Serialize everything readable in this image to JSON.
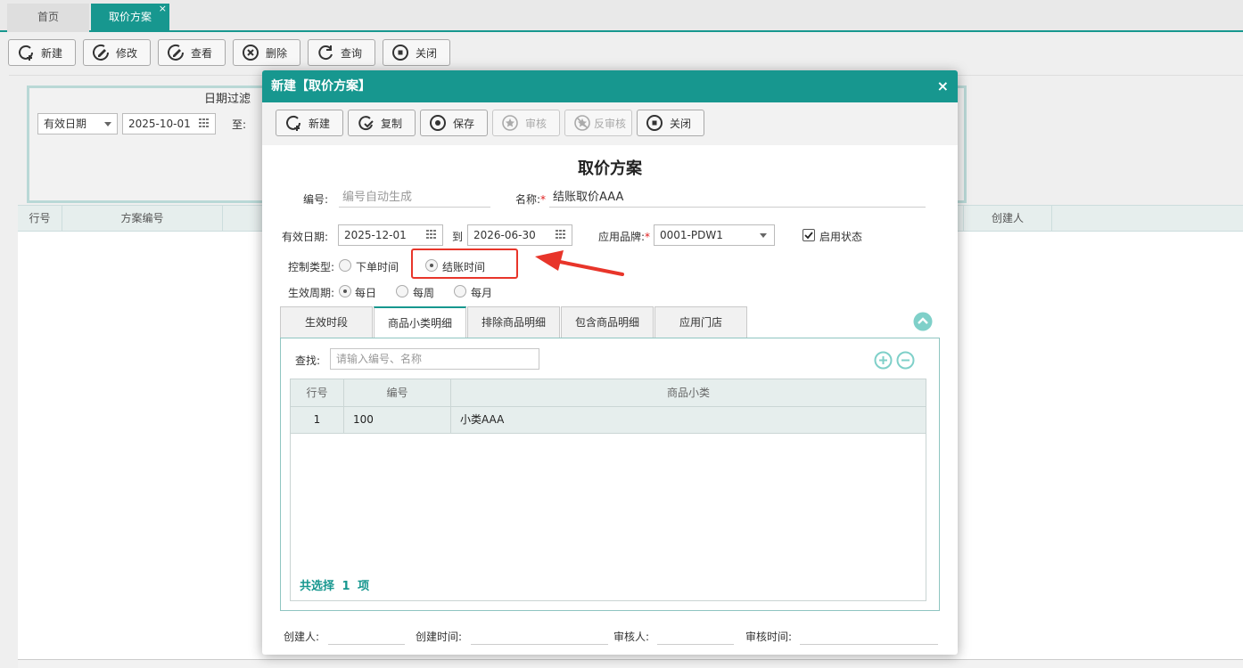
{
  "tabs": [
    {
      "label": "首页"
    },
    {
      "label": "取价方案",
      "close": "×"
    }
  ],
  "toolbar": {
    "new": "新建",
    "edit": "修改",
    "view": "查看",
    "delete": "删除",
    "query": "查询",
    "close": "关闭"
  },
  "filter": {
    "title": "日期过滤",
    "date_type": "有效日期",
    "start_date": "2025-10-01",
    "to_label": "至:"
  },
  "bg_grid": {
    "columns": [
      "行号",
      "方案编号",
      "创建人"
    ]
  },
  "dialog": {
    "title": "新建【取价方案】",
    "close": "×",
    "toolbar": {
      "new": "新建",
      "copy": "复制",
      "save": "保存",
      "audit": "审核",
      "unaudit": "反审核",
      "close": "关闭"
    },
    "form_title": "取价方案",
    "code_label": "编号:",
    "code_placeholder": "编号自动生成",
    "name_label": "名称:",
    "name_value": "结账取价AAA",
    "valid_date_label": "有效日期:",
    "start_date": "2025-12-01",
    "to_label": "到",
    "end_date": "2026-06-30",
    "brand_label": "应用品牌:",
    "brand_value": "0001-PDW1",
    "enabled_label": "启用状态",
    "enabled": true,
    "control_type_label": "控制类型:",
    "control_options": [
      "下单时间",
      "结账时间"
    ],
    "control_selected": "结账时间",
    "period_label": "生效周期:",
    "period_options": [
      "每日",
      "每周",
      "每月"
    ],
    "period_selected": "每日",
    "inner_tabs": [
      "生效时段",
      "商品小类明细",
      "排除商品明细",
      "包含商品明细",
      "应用门店"
    ],
    "active_inner_tab": "商品小类明细",
    "search_label": "查找:",
    "search_placeholder": "请输入编号、名称",
    "grid": {
      "columns": [
        "行号",
        "编号",
        "商品小类"
      ],
      "rows": [
        {
          "row": "1",
          "code": "100",
          "category": "小类AAA"
        }
      ]
    },
    "selection_summary": {
      "prefix": "共选择",
      "count": "1",
      "suffix": "项"
    },
    "footer": {
      "creator_label": "创建人:",
      "created_time_label": "创建时间:",
      "auditor_label": "审核人:",
      "audit_time_label": "审核时间:"
    }
  },
  "colors": {
    "accent": "#17978f",
    "annotation": "#e8352a"
  }
}
